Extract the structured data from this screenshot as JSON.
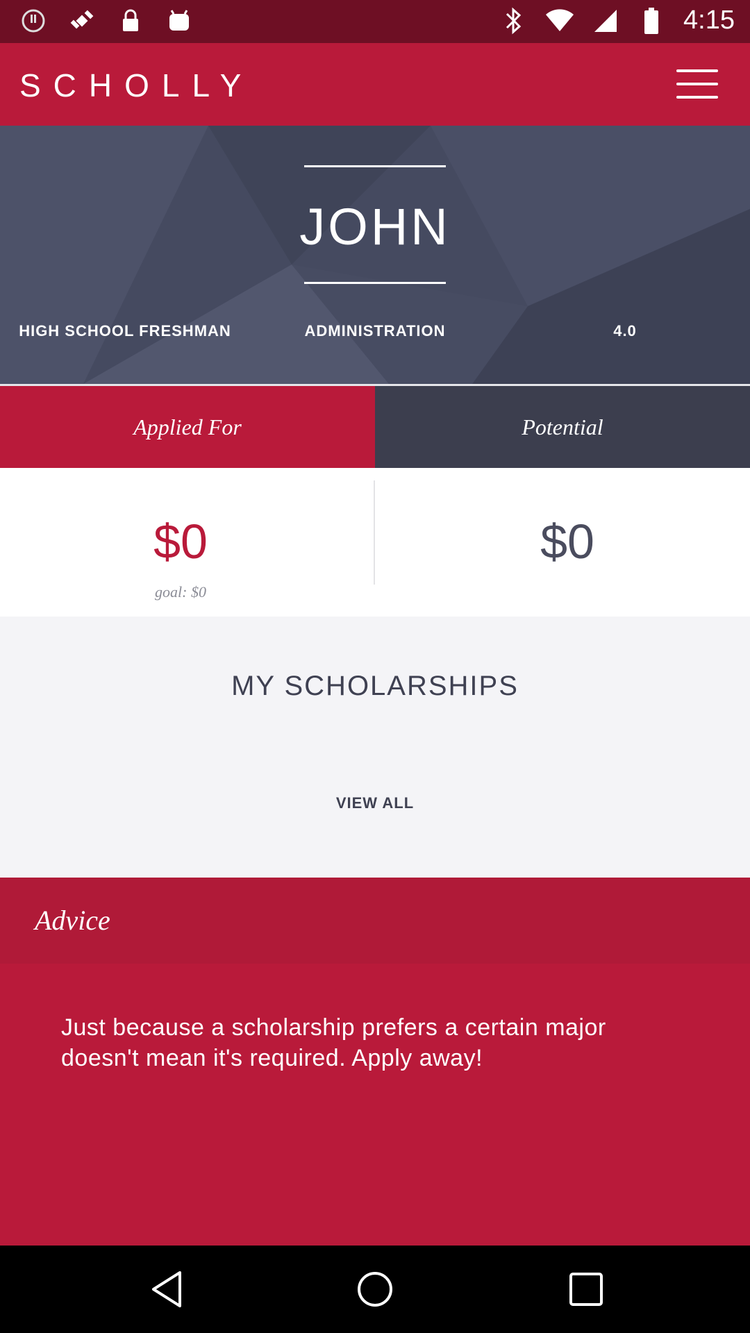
{
  "status_bar": {
    "time": "4:15",
    "left_icons": [
      "alert-icon",
      "satellite-icon",
      "lock-icon",
      "android-icon"
    ],
    "right_icons": [
      "bluetooth-icon",
      "wifi-icon",
      "signal-icon",
      "battery-icon"
    ]
  },
  "header": {
    "brand": "SCHOLLY",
    "menu_icon": "hamburger-menu-icon"
  },
  "profile": {
    "name": "JOHN",
    "grade": "HIGH SCHOOL FRESHMAN",
    "major": "ADMINISTRATION",
    "gpa": "4.0"
  },
  "tabs": [
    {
      "label": "Applied For",
      "active": true
    },
    {
      "label": "Potential",
      "active": false
    }
  ],
  "amounts": {
    "applied": "$0",
    "goal": "goal: $0",
    "potential": "$0"
  },
  "scholarships": {
    "title": "MY SCHOLARSHIPS",
    "view_all": "VIEW ALL"
  },
  "advice": {
    "title": "Advice",
    "text": "Just because a scholarship prefers a certain major doesn't mean it's required. Apply away!"
  },
  "nav_bar": {
    "icons": [
      "back-icon",
      "home-icon",
      "recents-icon"
    ]
  },
  "colors": {
    "status_bar": "#6e0f24",
    "brand_red": "#b91a3a",
    "advice_header": "#b01a38",
    "hero_bg": "#454a60",
    "tab_dark": "#3c3e4e",
    "text_dark": "#3f4152"
  }
}
